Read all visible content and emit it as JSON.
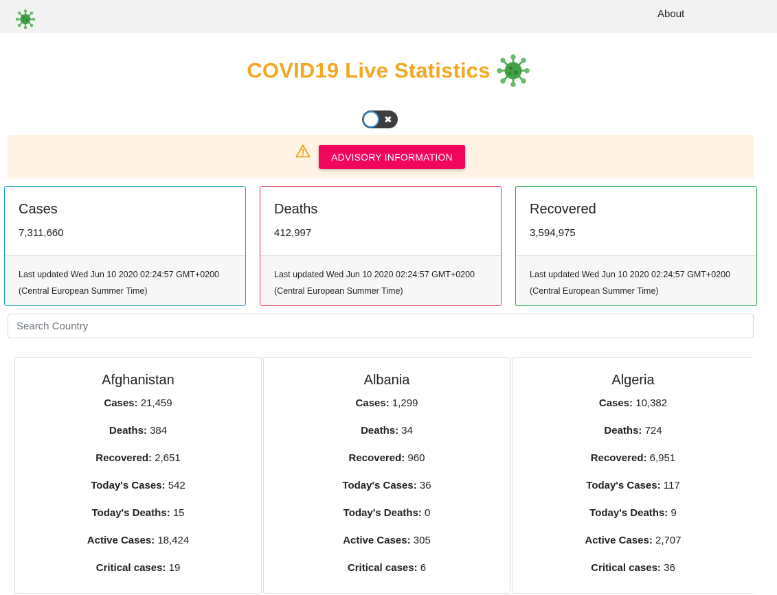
{
  "nav": {
    "about": "About"
  },
  "title": "COVID19 Live Statistics",
  "advisory": {
    "button_label": "ADVISORY INFORMATION"
  },
  "stats": [
    {
      "label": "Cases",
      "value": "7,311,660",
      "updated": "Last updated Wed Jun 10 2020 02:24:57 GMT+0200 (Central European Summer Time)",
      "color": "#17a2b8"
    },
    {
      "label": "Deaths",
      "value": "412,997",
      "updated": "Last updated Wed Jun 10 2020 02:24:57 GMT+0200 (Central European Summer Time)",
      "color": "#dc3545"
    },
    {
      "label": "Recovered",
      "value": "3,594,975",
      "updated": "Last updated Wed Jun 10 2020 02:24:57 GMT+0200 (Central European Summer Time)",
      "color": "#28a745"
    }
  ],
  "search": {
    "placeholder": "Search Country"
  },
  "field_labels": {
    "cases": "Cases:",
    "deaths": "Deaths:",
    "recovered": "Recovered:",
    "today_cases": "Today's Cases:",
    "today_deaths": "Today's Deaths:",
    "active": "Active Cases:",
    "critical": "Critical cases:"
  },
  "countries": [
    {
      "name": "Afghanistan",
      "cases": "21,459",
      "deaths": "384",
      "recovered": "2,651",
      "today_cases": "542",
      "today_deaths": "15",
      "active": "18,424",
      "critical": "19"
    },
    {
      "name": "Albania",
      "cases": "1,299",
      "deaths": "34",
      "recovered": "960",
      "today_cases": "36",
      "today_deaths": "0",
      "active": "305",
      "critical": "6"
    },
    {
      "name": "Algeria",
      "cases": "10,382",
      "deaths": "724",
      "recovered": "6,951",
      "today_cases": "117",
      "today_deaths": "9",
      "active": "2,707",
      "critical": "36"
    }
  ],
  "icons": {
    "logo": "virus-icon",
    "warning": "warning-icon",
    "toggle_off": "close-icon"
  },
  "colors": {
    "title": "#f5a623",
    "advisory_bg": "#fff3e5",
    "advisory_button": "#f1065e",
    "virus": "#5cb85c"
  }
}
